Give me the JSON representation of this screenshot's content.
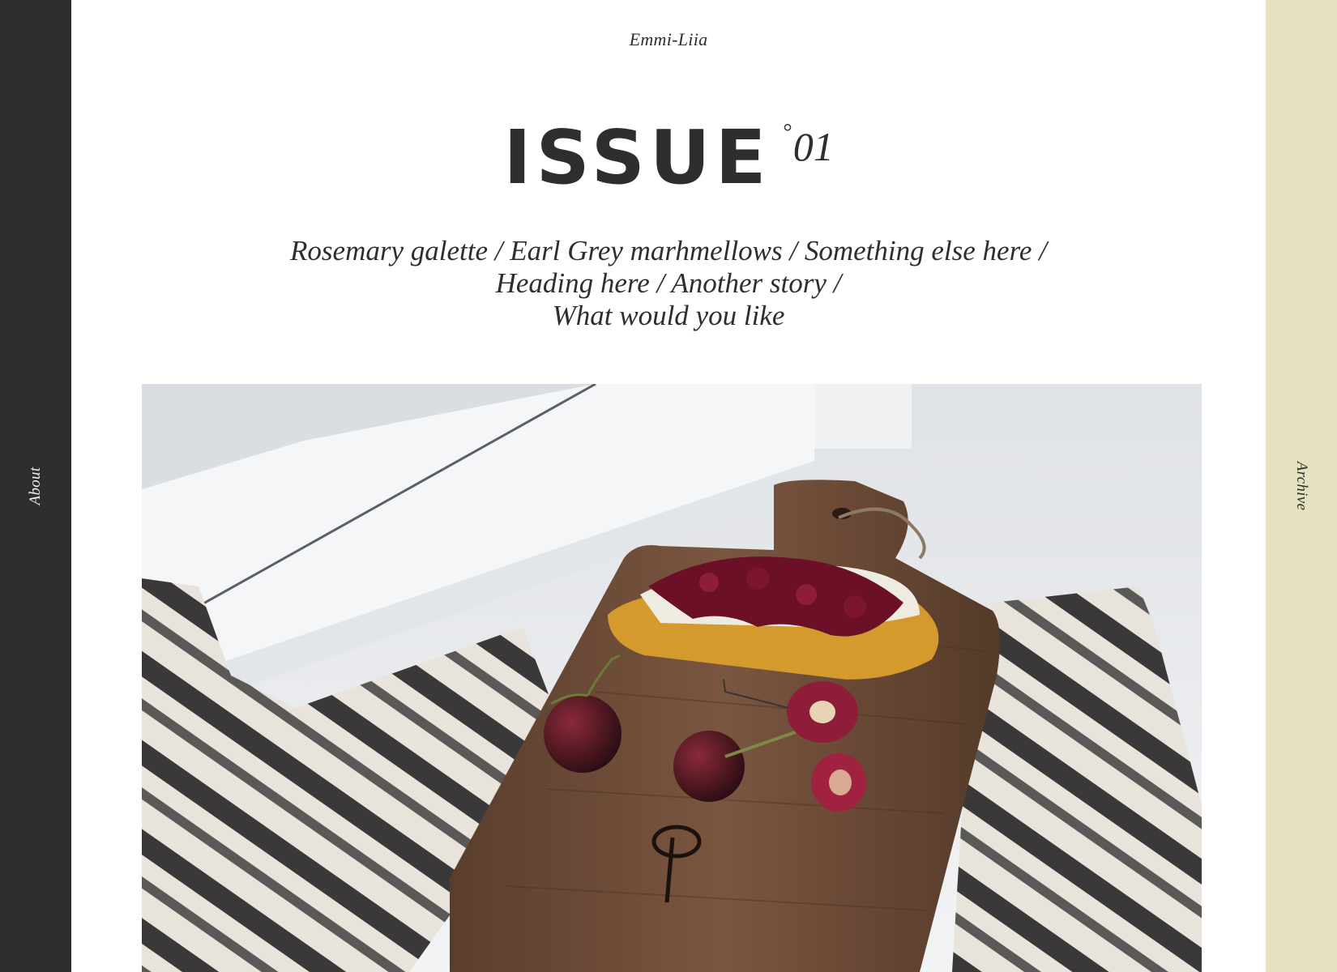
{
  "sidebar_left": {
    "label": "About",
    "color": "#2f2d2e"
  },
  "sidebar_right": {
    "label": "Archive",
    "color": "#e5e2c2"
  },
  "header": {
    "author": "Emmi-Liia",
    "issue_word": "ISSUE",
    "issue_degree": "°",
    "issue_number": "01"
  },
  "stories": {
    "line1": [
      "Rosemary galette",
      "Earl Grey marhmellows",
      "Something else here"
    ],
    "line2": [
      "Heading here",
      "Another story"
    ],
    "line3": [
      "What would you like"
    ],
    "separator": "/"
  },
  "hero": {
    "subject": "cherry-crostini-on-wooden-board-photo"
  }
}
